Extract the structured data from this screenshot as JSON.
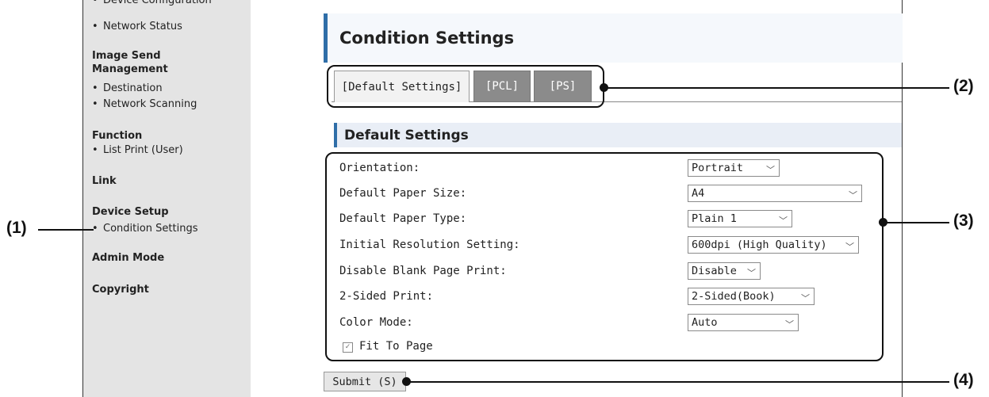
{
  "sidebar": {
    "items": [
      {
        "type": "link",
        "label": "Device Configuration"
      },
      {
        "type": "link",
        "label": "Network Status"
      },
      {
        "type": "heading",
        "label": "Image Send Management"
      },
      {
        "type": "link",
        "label": "Destination"
      },
      {
        "type": "link",
        "label": "Network Scanning"
      },
      {
        "type": "heading",
        "label": "Function"
      },
      {
        "type": "link",
        "label": "List Print (User)"
      },
      {
        "type": "heading",
        "label": "Link"
      },
      {
        "type": "heading",
        "label": "Device Setup"
      },
      {
        "type": "link",
        "label": "Condition Settings"
      },
      {
        "type": "heading",
        "label": "Admin Mode"
      },
      {
        "type": "heading",
        "label": "Copyright"
      }
    ]
  },
  "main": {
    "title": "Condition Settings",
    "tabs": [
      "[Default Settings]",
      "[PCL]",
      "[PS]"
    ],
    "section_title": "Default Settings",
    "settings": [
      {
        "label": "Orientation:",
        "value": "Portrait"
      },
      {
        "label": "Default Paper Size:",
        "value": "A4"
      },
      {
        "label": "Default Paper Type:",
        "value": "Plain 1"
      },
      {
        "label": "Initial Resolution Setting:",
        "value": "600dpi (High Quality)"
      },
      {
        "label": "Disable Blank Page Print:",
        "value": "Disable"
      },
      {
        "label": "2-Sided Print:",
        "value": "2-Sided(Book)"
      },
      {
        "label": "Color Mode:",
        "value": "Auto"
      }
    ],
    "fit_to_page": {
      "label": "Fit To Page",
      "checked": true
    },
    "submit_label": "Submit (S)"
  },
  "callouts": [
    "(1)",
    "(2)",
    "(3)",
    "(4)"
  ],
  "colors": {
    "accent": "#2f6ea8",
    "sidebar_bg": "#e4e4e4",
    "inactive_tab": "#8b8b8b"
  }
}
